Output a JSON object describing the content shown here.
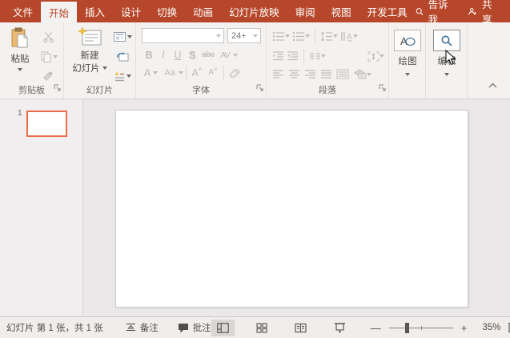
{
  "colors": {
    "accent": "#B7472A",
    "ribbon_bg": "#F4F2F0",
    "canvas_bg": "#EAE8E8",
    "selected_slide_border": "#EC6B4C",
    "disabled_icon": "#BDBBB9",
    "blue_icon": "#41719C"
  },
  "menu": {
    "tabs": [
      {
        "label": "文件"
      },
      {
        "label": "开始",
        "selected": true
      },
      {
        "label": "插入"
      },
      {
        "label": "设计"
      },
      {
        "label": "切换"
      },
      {
        "label": "动画"
      },
      {
        "label": "幻灯片放映"
      },
      {
        "label": "审阅"
      },
      {
        "label": "视图"
      },
      {
        "label": "开发工具"
      }
    ],
    "tell_me": "告诉我",
    "share": "共享"
  },
  "ribbon": {
    "clipboard": {
      "label": "剪贴板",
      "paste": "粘贴"
    },
    "slides": {
      "label": "幻灯片",
      "new_slide_line1": "新建",
      "new_slide_line2": "幻灯片"
    },
    "font": {
      "label": "字体",
      "name": "",
      "size": "24+",
      "bold": "B",
      "italic": "I",
      "underline": "U",
      "shadow": "S",
      "strike": "abc",
      "spacing": "AV",
      "color": "A",
      "case": "Aa",
      "grow": "A",
      "shrink": "A"
    },
    "paragraph": {
      "label": "段落"
    },
    "drawing": {
      "label": "绘图"
    },
    "editing": {
      "label": "编辑"
    }
  },
  "slides_panel": {
    "slide_number": "1"
  },
  "status": {
    "slide_info": "幻灯片 第 1 张，共 1 张",
    "notes": "备注",
    "comments": "批注",
    "zoom_out": "—",
    "zoom_in": "+",
    "zoom": "35%"
  }
}
